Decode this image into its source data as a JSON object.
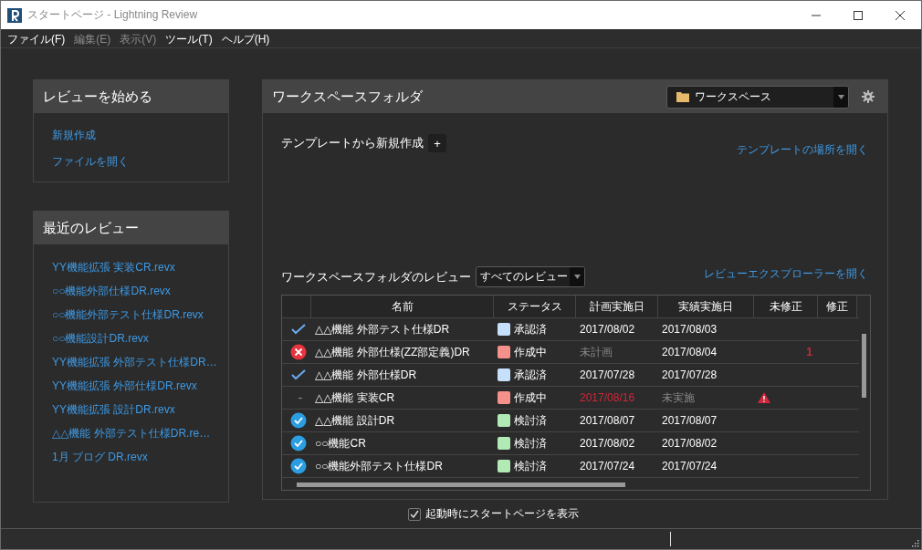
{
  "window": {
    "title": "スタートページ - Lightning Review"
  },
  "menu": [
    {
      "label": "ファイル(F)",
      "disabled": false
    },
    {
      "label": "編集(E)",
      "disabled": true
    },
    {
      "label": "表示(V)",
      "disabled": true
    },
    {
      "label": "ツール(T)",
      "disabled": false
    },
    {
      "label": "ヘルプ(H)",
      "disabled": false
    }
  ],
  "start_panel": {
    "title": "レビューを始める",
    "links": [
      "新規作成",
      "ファイルを開く"
    ]
  },
  "recent_panel": {
    "title": "最近のレビュー",
    "links": [
      "YY機能拡張 実装CR.revx",
      "○○機能外部仕様DR.revx",
      "○○機能外部テスト仕様DR.revx",
      "○○機能設計DR.revx",
      "YY機能拡張 外部テスト仕様DR…",
      "YY機能拡張 外部仕様DR.revx",
      "YY機能拡張 設計DR.revx",
      "△△機能 外部テスト仕様DR.re…",
      "1月 ブログ DR.revx"
    ]
  },
  "workspace": {
    "title": "ワークスペースフォルダ",
    "folder_select": "ワークスペース",
    "template_label": "テンプレートから新規作成",
    "add_button": "+",
    "template_link": "テンプレートの場所を開く",
    "reviews_label": "ワークスペースフォルダのレビュー",
    "filter_select": "すべてのレビュー",
    "explorer_link": "レビューエクスプローラーを開く",
    "table": {
      "columns": [
        "名前",
        "ステータス",
        "計画実施日",
        "実績実施日",
        "未修正",
        "修正"
      ],
      "rows": [
        {
          "kind": "approved",
          "name": "△△機能 外部テスト仕様DR",
          "status": "承認済",
          "color": "#c6e0fb",
          "planned": "2017/08/02",
          "planned_muted": false,
          "planned_overdue": false,
          "actual": "2017/08/03",
          "actual_muted": false
        },
        {
          "kind": "error",
          "name": "△△機能 外部仕様(ZZ部定義)DR",
          "status": "作成中",
          "color": "#f3918a",
          "planned": "未計画",
          "planned_muted": true,
          "planned_overdue": false,
          "actual": "2017/08/04",
          "actual_muted": false,
          "unfixed": "1"
        },
        {
          "kind": "approved",
          "name": "△△機能 外部仕様DR",
          "status": "承認済",
          "color": "#c6e0fb",
          "planned": "2017/07/28",
          "planned_muted": false,
          "planned_overdue": false,
          "actual": "2017/07/28",
          "actual_muted": false
        },
        {
          "kind": "symbol",
          "symbol": "-",
          "name": "△△機能 実装CR",
          "status": "作成中",
          "color": "#f3918a",
          "planned": "2017/08/16",
          "planned_muted": false,
          "planned_overdue": true,
          "actual": "未実施",
          "actual_muted": true,
          "warning": true
        },
        {
          "kind": "reviewed",
          "name": "△△機能 設計DR",
          "status": "検討済",
          "color": "#b2eab5",
          "planned": "2017/08/07",
          "planned_muted": false,
          "planned_overdue": false,
          "actual": "2017/08/07",
          "actual_muted": false
        },
        {
          "kind": "reviewed",
          "name": "○○機能CR",
          "status": "検討済",
          "color": "#b2eab5",
          "planned": "2017/08/02",
          "planned_muted": false,
          "planned_overdue": false,
          "actual": "2017/08/02",
          "actual_muted": false
        },
        {
          "kind": "reviewed",
          "name": "○○機能外部テスト仕様DR",
          "status": "検討済",
          "color": "#b2eab5",
          "planned": "2017/07/24",
          "planned_muted": false,
          "planned_overdue": false,
          "actual": "2017/07/24",
          "actual_muted": false
        }
      ]
    }
  },
  "startup_checkbox": {
    "label": "起動時にスタートページを表示",
    "checked": true
  }
}
